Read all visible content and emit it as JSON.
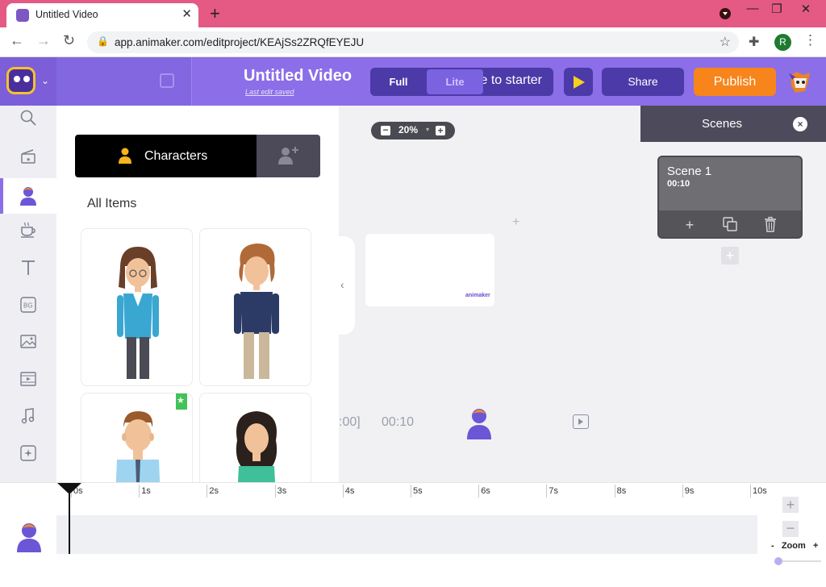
{
  "browser": {
    "tab_title": "Untitled Video",
    "tab_close": "✕",
    "new_tab": "+",
    "url": "app.animaker.com/editproject/KEAjSs2ZRQfEYEJU",
    "profile_initial": "R",
    "window_minimize": "—",
    "window_restore": "❐",
    "window_close": "✕"
  },
  "header": {
    "video_title": "Untitled Video",
    "last_edit": "Last edit saved",
    "switch_text": "e to starter",
    "mode_full": "Full",
    "mode_lite": "Lite",
    "share": "Share",
    "publish": "Publish"
  },
  "library": {
    "tab_label": "Characters",
    "section_title": "All Items"
  },
  "canvas": {
    "zoom_minus": "−",
    "zoom_value": "20%",
    "zoom_dropdown": "▾",
    "zoom_plus": "+",
    "collapse_arrow": "‹",
    "add": "+",
    "watermark": "animaker",
    "timer_left": ":00]",
    "timer_right": "00:10"
  },
  "scenes": {
    "title": "Scenes",
    "close": "×",
    "items": [
      {
        "name": "Scene 1",
        "duration": "00:10"
      }
    ],
    "add_tool": "+",
    "add_scene": "+"
  },
  "timeline": {
    "ticks": [
      "0s",
      "1s",
      "2s",
      "3s",
      "4s",
      "5s",
      "6s",
      "7s",
      "8s",
      "9s",
      "10s"
    ],
    "zoom_in": "+",
    "zoom_out": "−",
    "zoom_label": "-   Zoom   +",
    "zoom_level": 0.05
  },
  "colors": {
    "brand_purple": "#8b6ee8",
    "publish_orange": "#f7851c",
    "premium_green": "#41c35a",
    "tab_bar_pink": "#e45a85"
  }
}
